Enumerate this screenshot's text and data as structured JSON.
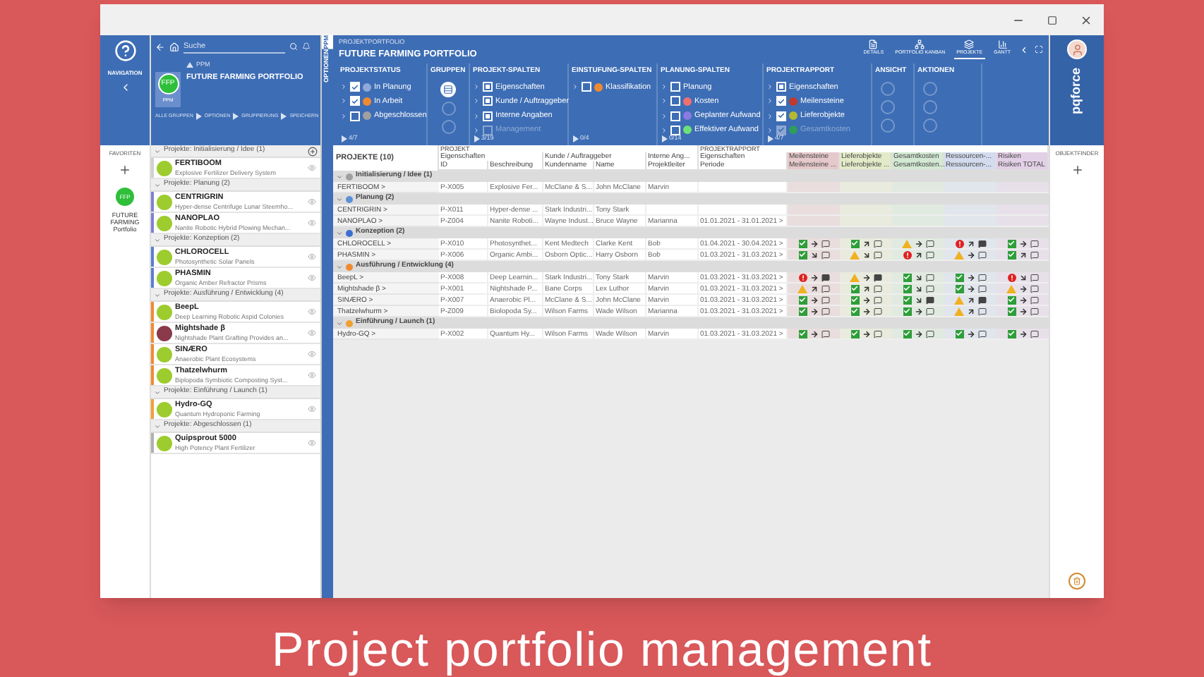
{
  "caption": "Project portfolio management",
  "nav": {
    "label": "NAVIGATION",
    "favorites_label": "FAVORITEN",
    "favorite": {
      "badge": "FFP",
      "name": "FUTURE FARMING Portfolio"
    }
  },
  "left_panel": {
    "search": {
      "placeholder": "Suche"
    },
    "breadcrumb": "PPM",
    "title": "FUTURE FARMING PORTFOLIO",
    "badge": "FFP",
    "badge_label": "PPM",
    "path": [
      "ALLE GRUPPEN",
      "OPTIONEN",
      "GRUPPIERUNG",
      "SPEICHERN"
    ]
  },
  "side_tabs": [
    {
      "label": "PPM",
      "selected": true
    },
    {
      "label": "OPTIONEN",
      "selected": false
    }
  ],
  "project_list": [
    {
      "label": "Projekte: Initialisierung / Idee",
      "count": "(1)",
      "color": "#d0d0d0",
      "items": [
        {
          "name": "FERTIBOOM",
          "description": "Explosive Fertilizer Delivery System",
          "kind": "badge"
        }
      ]
    },
    {
      "label": "Projekte: Planung",
      "count": "(2)",
      "color": "#7f7fd0",
      "items": [
        {
          "name": "CENTRIGRIN",
          "description": "Hyper-dense Centrifuge Lunar Steemho...",
          "kind": "badge"
        },
        {
          "name": "NANOPLAO",
          "description": "Nanite Robotic Hybrid Plowing Mechan...",
          "kind": "badge"
        }
      ]
    },
    {
      "label": "Projekte: Konzeption",
      "count": "(2)",
      "color": "#5a7fd0",
      "items": [
        {
          "name": "CHLOROCELL",
          "description": "Photosynthetic Solar Panels",
          "kind": "badge"
        },
        {
          "name": "PHASMIN",
          "description": "Organic Amber Refractor Prisms",
          "kind": "badge"
        }
      ]
    },
    {
      "label": "Projekte: Ausführung / Entwicklung",
      "count": "(4)",
      "color": "#f08a30",
      "items": [
        {
          "name": "BeepL",
          "description": "Deep Learning Robotic Aspid Colonies",
          "kind": "badge"
        },
        {
          "name": "Mightshade β",
          "description": "Nightshade Plant Grafting Provides an...",
          "kind": "photo"
        },
        {
          "name": "SINÆRO",
          "description": "Anaerobic Plant Ecosystems",
          "kind": "badge"
        },
        {
          "name": "Thatzelwhurm",
          "description": "Biplopoda Symbiotic Composting Syst...",
          "kind": "badge"
        }
      ]
    },
    {
      "label": "Projekte: Einführung / Launch",
      "count": "(1)",
      "color": "#f0a030",
      "items": [
        {
          "name": "Hydro-GQ",
          "description": "Quantum Hydroponic Farming",
          "kind": "badge"
        }
      ]
    },
    {
      "label": "Projekte: Abgeschlossen",
      "count": "(1)",
      "color": "#b0b0b0",
      "items": [
        {
          "name": "Quipsprout 5000",
          "description": "High Potency Plant Fertilizer",
          "kind": "badge"
        }
      ]
    }
  ],
  "header": {
    "subtitle": "PROJEKTPORTFOLIO",
    "title": "FUTURE FARMING PORTFOLIO",
    "views": [
      {
        "label": "DETAILS",
        "selected": false
      },
      {
        "label": "PORTFOLIO KANBAN",
        "selected": false
      },
      {
        "label": "PROJEKTE",
        "selected": true
      },
      {
        "label": "GANTT",
        "selected": false
      }
    ],
    "logo": "pqforce"
  },
  "ribbon": [
    {
      "title": "PROJEKTSTATUS",
      "kind": "checklist",
      "footer": "4/7",
      "items": [
        {
          "label": "In Planung",
          "checked": true,
          "partial": false,
          "color": "#8fa9d9",
          "disabled": false
        },
        {
          "label": "In Arbeit",
          "checked": true,
          "partial": false,
          "color": "#f08a30",
          "disabled": false
        },
        {
          "label": "Abgeschlossen",
          "checked": false,
          "partial": false,
          "color": "#a0a0a0",
          "disabled": false
        }
      ]
    },
    {
      "title": "GRUPPEN",
      "kind": "groups"
    },
    {
      "title": "PROJEKT-SPALTEN",
      "kind": "checklist",
      "footer": "3/19",
      "items": [
        {
          "label": "Eigenschaften",
          "checked": true,
          "partial": true,
          "disabled": false
        },
        {
          "label": "Kunde / Auftraggeber",
          "checked": true,
          "partial": true,
          "disabled": false
        },
        {
          "label": "Interne Angaben",
          "checked": true,
          "partial": true,
          "disabled": false
        },
        {
          "label": "Management",
          "checked": false,
          "partial": false,
          "disabled": true
        }
      ]
    },
    {
      "title": "EINSTUFUNG-SPALTEN",
      "kind": "checklist",
      "footer": "0/4",
      "items": [
        {
          "label": "Klassifikation",
          "checked": false,
          "partial": false,
          "color": "#f08a30",
          "disabled": false
        }
      ]
    },
    {
      "title": "PLANUNG-SPALTEN",
      "kind": "checklist",
      "footer": "0/14",
      "items": [
        {
          "label": "Planung",
          "checked": false,
          "partial": false,
          "disabled": false
        },
        {
          "label": "Kosten",
          "checked": false,
          "partial": false,
          "color": "#f07070",
          "disabled": false
        },
        {
          "label": "Geplanter Aufwand",
          "checked": false,
          "partial": false,
          "color": "#8a7be0",
          "disabled": false
        },
        {
          "label": "Effektiver Aufwand",
          "checked": false,
          "partial": false,
          "color": "#6ee07a",
          "disabled": false
        }
      ]
    },
    {
      "title": "PROJEKTRAPPORT",
      "kind": "checklist",
      "footer": "4/7",
      "items": [
        {
          "label": "Eigenschaften",
          "checked": true,
          "partial": true,
          "disabled": false
        },
        {
          "label": "Meilensteine",
          "checked": true,
          "partial": false,
          "color": "#c0392b",
          "disabled": false
        },
        {
          "label": "Lieferobjekte",
          "checked": true,
          "partial": false,
          "color": "#b5b830",
          "disabled": false
        },
        {
          "label": "Gesamtkosten",
          "checked": true,
          "partial": false,
          "color": "#2e9e5a",
          "disabled": true
        }
      ]
    },
    {
      "title": "ANSICHT",
      "kind": "slots"
    },
    {
      "title": "AKTIONEN",
      "kind": "slots"
    }
  ],
  "table": {
    "title": "PROJEKTE",
    "count": "(10)",
    "column_groups": [
      {
        "label": "PROJEKT",
        "columns": [
          {
            "label": "Eigenschaften",
            "fields": [
              "ID",
              "Beschreibung"
            ]
          },
          {
            "label": "Kunde / Auftraggeber",
            "fields": [
              "Kundenname",
              "Name"
            ]
          },
          {
            "label": "Interne Ang...",
            "fields": [
              "Projektleiter"
            ]
          }
        ]
      },
      {
        "label": "PROJEKTRAPPORT",
        "columns": [
          {
            "label": "Eigenschaften",
            "fields": [
              "Periode"
            ]
          },
          {
            "label": "Meilensteine",
            "fields": [
              "Meilensteine ..."
            ],
            "color": "#e6c9cb"
          },
          {
            "label": "Lieferobjekte",
            "fields": [
              "Lieferobjekte ..."
            ],
            "color": "#e3eac8"
          },
          {
            "label": "Gesamtkosten",
            "fields": [
              "Gesamtkosten..."
            ],
            "color": "#d3e9d3"
          },
          {
            "label": "Ressourcen-...",
            "fields": [
              "Ressourcen-..."
            ],
            "color": "#d3dbee"
          },
          {
            "label": "Risiken",
            "fields": [
              "Risiken TOTAL"
            ],
            "color": "#e2d0e6"
          }
        ]
      }
    ],
    "rows": [
      {
        "kind": "group",
        "label": "Initialisierung / Idee",
        "count": "(1)",
        "color": "#9e9e9e"
      },
      {
        "kind": "project",
        "name": "FERTIBOOM >",
        "cells": [
          "P-X005",
          "Explosive Fer...",
          "McClane & S...",
          "John McClane",
          "Marvin",
          null
        ]
      },
      {
        "kind": "group",
        "label": "Planung",
        "count": "(2)",
        "color": "#5b8fd8"
      },
      {
        "kind": "project",
        "name": "CENTRIGRIN >",
        "cells": [
          "P-X011",
          "Hyper-dense ...",
          "Stark Industri...",
          "Tony Stark",
          null,
          null
        ]
      },
      {
        "kind": "project",
        "name": "NANOPLAO >",
        "cells": [
          "P-Z004",
          "Nanite Roboti...",
          "Wayne Indust...",
          "Bruce Wayne",
          "Marianna",
          "01.01.2021 - 31.01.2021 >"
        ]
      },
      {
        "kind": "group",
        "label": "Konzeption",
        "count": "(2)",
        "color": "#3a6fd0"
      },
      {
        "kind": "project",
        "name": "CHLOROCELL >",
        "cells": [
          "P-X010",
          "Photosynthet...",
          "Kent Medtech",
          "Clarke Kent",
          "Bob",
          "01.04.2021 - 30.04.2021 >"
        ],
        "report": [
          {
            "kind": "ok",
            "rising": false,
            "falling": false,
            "comment": false
          },
          {
            "kind": "ok",
            "rising": true,
            "falling": false,
            "comment": false
          },
          {
            "kind": "warn",
            "rising": false,
            "falling": false,
            "comment": false
          },
          {
            "kind": "error",
            "rising": true,
            "falling": false,
            "comment": true
          },
          {
            "kind": "ok",
            "rising": false,
            "falling": false,
            "comment": false
          }
        ]
      },
      {
        "kind": "project",
        "name": "PHASMIN >",
        "cells": [
          "P-X006",
          "Organic Ambi...",
          "Osborn Optic...",
          "Harry Osborn",
          "Bob",
          "01.03.2021 - 31.03.2021 >"
        ],
        "report": [
          {
            "kind": "ok",
            "rising": false,
            "falling": true,
            "comment": false
          },
          {
            "kind": "warn",
            "rising": false,
            "falling": true,
            "comment": false
          },
          {
            "kind": "error",
            "rising": true,
            "falling": false,
            "comment": false
          },
          {
            "kind": "warn",
            "rising": false,
            "falling": false,
            "comment": false
          },
          {
            "kind": "ok",
            "rising": true,
            "falling": false,
            "comment": false
          }
        ]
      },
      {
        "kind": "group",
        "label": "Ausführung / Entwicklung",
        "count": "(4)",
        "color": "#f08a30"
      },
      {
        "kind": "project",
        "name": "BeepL >",
        "cells": [
          "P-X008",
          "Deep Learnin...",
          "Stark Industri...",
          "Tony Stark",
          "Marvin",
          "01.03.2021 - 31.03.2021 >"
        ],
        "report": [
          {
            "kind": "error",
            "rising": false,
            "falling": false,
            "comment": true
          },
          {
            "kind": "warn",
            "rising": false,
            "falling": false,
            "comment": true
          },
          {
            "kind": "ok",
            "rising": false,
            "falling": true,
            "comment": false
          },
          {
            "kind": "ok",
            "rising": false,
            "falling": false,
            "comment": false
          },
          {
            "kind": "error",
            "rising": false,
            "falling": true,
            "comment": false
          }
        ]
      },
      {
        "kind": "project",
        "name": "Mightshade β >",
        "cells": [
          "P-X001",
          "Nightshade P...",
          "Bane Corps",
          "Lex Luthor",
          "Marvin",
          "01.03.2021 - 31.03.2021 >"
        ],
        "report": [
          {
            "kind": "warn",
            "rising": true,
            "falling": false,
            "comment": false
          },
          {
            "kind": "ok",
            "rising": true,
            "falling": false,
            "comment": false
          },
          {
            "kind": "ok",
            "rising": false,
            "falling": true,
            "comment": false
          },
          {
            "kind": "ok",
            "rising": false,
            "falling": false,
            "comment": false
          },
          {
            "kind": "warn",
            "rising": false,
            "falling": false,
            "comment": false
          }
        ]
      },
      {
        "kind": "project",
        "name": "SINÆRO >",
        "cells": [
          "P-X007",
          "Anaerobic Pl...",
          "McClane & S...",
          "John McClane",
          "Marvin",
          "01.03.2021 - 31.03.2021 >"
        ],
        "report": [
          {
            "kind": "ok",
            "rising": false,
            "falling": false,
            "comment": false
          },
          {
            "kind": "ok",
            "rising": false,
            "falling": false,
            "comment": false
          },
          {
            "kind": "ok",
            "rising": false,
            "falling": true,
            "comment": true
          },
          {
            "kind": "warn",
            "rising": true,
            "falling": false,
            "comment": true
          },
          {
            "kind": "ok",
            "rising": false,
            "falling": false,
            "comment": false
          }
        ]
      },
      {
        "kind": "project",
        "name": "Thatzelwhurm >",
        "cells": [
          "P-Z009",
          "Biolopoda Sy...",
          "Wilson Farms",
          "Wade Wilson",
          "Marianna",
          "01.03.2021 - 31.03.2021 >"
        ],
        "report": [
          {
            "kind": "ok",
            "rising": false,
            "falling": false,
            "comment": false
          },
          {
            "kind": "ok",
            "rising": false,
            "falling": false,
            "comment": false
          },
          {
            "kind": "ok",
            "rising": false,
            "falling": false,
            "comment": false
          },
          {
            "kind": "warn",
            "rising": true,
            "falling": false,
            "comment": false
          },
          {
            "kind": "ok",
            "rising": false,
            "falling": false,
            "comment": false
          }
        ]
      },
      {
        "kind": "group",
        "label": "Einführung / Launch",
        "count": "(1)",
        "color": "#f0a030"
      },
      {
        "kind": "project",
        "name": "Hydro-GQ >",
        "cells": [
          "P-X002",
          "Quantum Hy...",
          "Wilson Farms",
          "Wade Wilson",
          "Marvin",
          "01.03.2021 - 31.03.2021 >"
        ],
        "report": [
          {
            "kind": "ok",
            "rising": false,
            "falling": false,
            "comment": false
          },
          {
            "kind": "ok",
            "rising": false,
            "falling": false,
            "comment": false
          },
          {
            "kind": "ok",
            "rising": false,
            "falling": false,
            "comment": false
          },
          {
            "kind": "ok",
            "rising": false,
            "falling": false,
            "comment": false
          },
          {
            "kind": "ok",
            "rising": false,
            "falling": false,
            "comment": false
          }
        ]
      }
    ]
  },
  "finder": {
    "label": "OBJEKTFINDER"
  }
}
